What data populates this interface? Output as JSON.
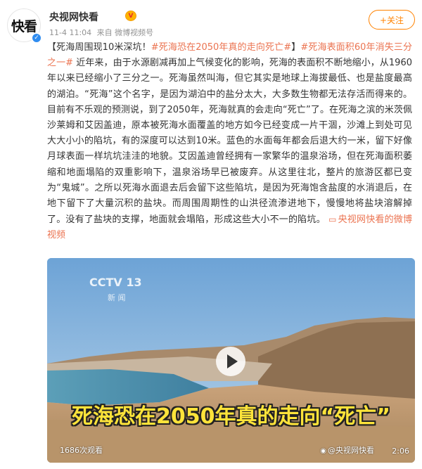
{
  "header": {
    "avatar_text": "快看",
    "username": "央视网快看",
    "vip_badge": "V",
    "time": "11-4 11:04",
    "source": "来自 微博视频号",
    "follow_label": "+关注"
  },
  "post": {
    "bracket_open": "【",
    "headline": "死海周围现10米深坑！",
    "tag1": "#死海恐在2050年真的走向死亡#",
    "bracket_close": "】",
    "tag2": "#死海表面积60年消失三分之一#",
    "body": "近年来，由于水源剧减再加上气候变化的影响，死海的表面积不断地缩小，从1960年以来已经缩小了三分之一。死海虽然叫海，但它其实是地球上海拔最低、也是盐度最高的湖泊。“死海”这个名字，是因为湖泊中的盐分太大，大多数生物都无法存活而得来的。目前有不乐观的预测说，到了2050年，死海就真的会走向“死亡”了。在死海之滨的米茨佩沙莱姆和艾因盖迪，原本被死海水面覆盖的地方如今已经变成一片干涸，沙滩上到处可见大大小小的陷坑，有的深度可以达到10米。蓝色的水面每年都会后退大约一米，留下好像月球表面一样坑坑洼洼的地貌。艾因盖迪曾经拥有一家繁华的温泉浴场，但在死海面积萎缩和地面塌陷的双重影响下，温泉浴场早已被废弃。从这里往北，整片的旅游区都已变为“鬼城”。之所以死海水面退去后会留下这些陷坑，是因为死海饱含盐度的水消退后，在地下留下了大量沉积的盐块。而周围周期性的山洪径流渗进地下，慢慢地将盐块溶解掉了。没有了盐块的支撑，地面就会塌陷，形成这些大小不一的陷坑。",
    "source_link": "央视网快看的微博视频"
  },
  "video": {
    "cctv_logo": "CCTV 13",
    "cctv_sub": "新 闻",
    "caption": "死海恐在2050年真的走向“死亡”",
    "views": "1686次观看",
    "watermark": "@央视网快看",
    "duration": "2:06"
  },
  "colors": {
    "tag": "#eb7350",
    "follow": "#ff8200",
    "caption": "#fde33a"
  }
}
